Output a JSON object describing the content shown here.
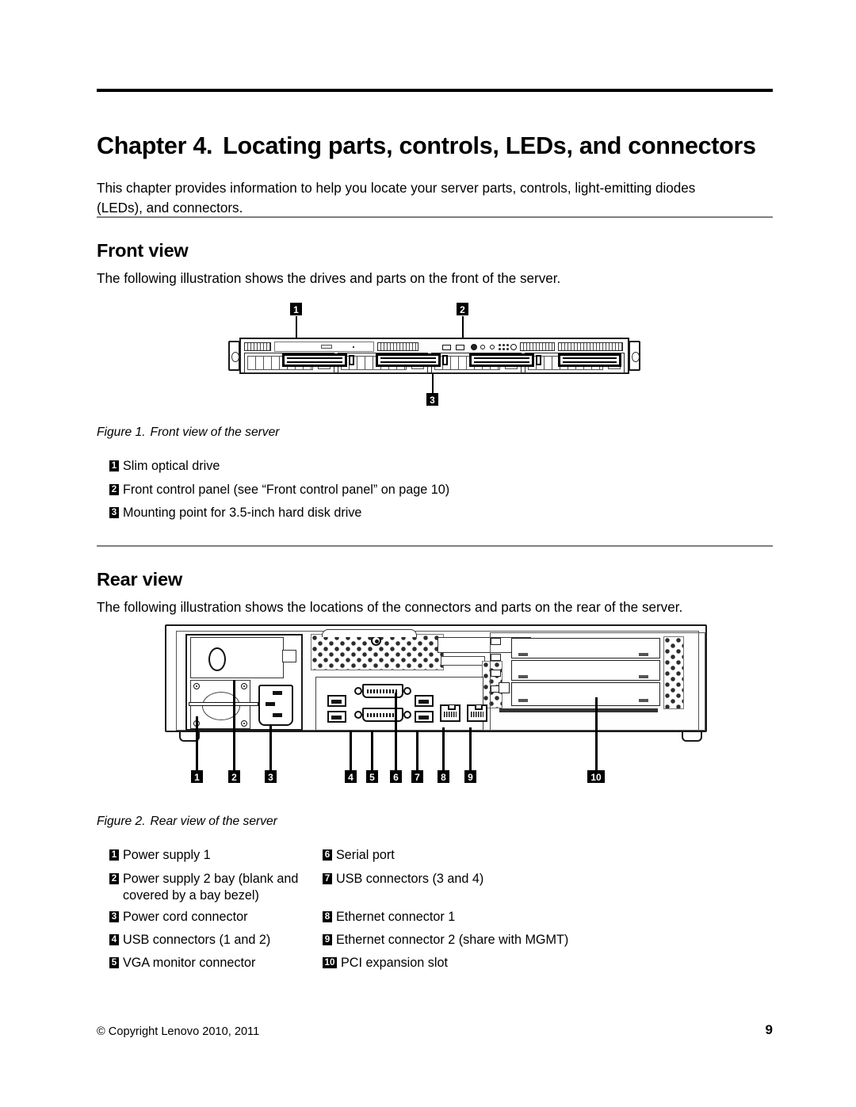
{
  "document": {
    "chapter_number": "Chapter 4.",
    "chapter_title": "Locating parts, controls, LEDs, and connectors",
    "intro": "This chapter provides information to help you locate your server parts, controls, light-emitting diodes (LEDs), and connectors."
  },
  "front_section": {
    "heading": "Front view",
    "body": "The following illustration shows the drives and parts on the front of the server.",
    "figure_label": "Figure 1.",
    "figure_caption": "Front view of the server",
    "callouts": [
      {
        "num": "1",
        "label": "Slim optical drive"
      },
      {
        "num": "2",
        "label": "Front control panel (see “Front control panel” on page 10)"
      },
      {
        "num": "3",
        "label": "Mounting point for 3.5-inch hard disk drive"
      }
    ],
    "diagram_callouts": [
      "1",
      "2",
      "3"
    ]
  },
  "rear_section": {
    "heading": "Rear view",
    "body": "The following illustration shows the locations of the connectors and parts on the rear of the server.",
    "figure_label": "Figure 2.",
    "figure_caption": "Rear view of the server",
    "callouts_left": [
      {
        "num": "1",
        "label": "Power supply 1"
      },
      {
        "num": "2",
        "label": "Power supply 2 bay (blank and covered by a bay bezel)"
      },
      {
        "num": "3",
        "label": "Power cord connector"
      },
      {
        "num": "4",
        "label": "USB connectors (1 and 2)"
      },
      {
        "num": "5",
        "label": "VGA monitor connector"
      }
    ],
    "callouts_right": [
      {
        "num": "6",
        "label": "Serial port"
      },
      {
        "num": "7",
        "label": "USB connectors (3 and 4)"
      },
      {
        "num": "8",
        "label": "Ethernet connector 1"
      },
      {
        "num": "9",
        "label": "Ethernet connector 2 (share with MGMT)"
      },
      {
        "num": "10",
        "label": "PCI expansion slot"
      }
    ],
    "diagram_callouts": [
      "1",
      "2",
      "3",
      "4",
      "5",
      "6",
      "7",
      "8",
      "9",
      "10"
    ]
  },
  "footer": {
    "copyright": "© Copyright Lenovo 2010, 2011",
    "page_number": "9"
  },
  "colors": {
    "text": "#000000",
    "rule_top": "#000000",
    "rule_section": "#808080",
    "callout_bg": "#000000",
    "callout_fg": "#ffffff",
    "page_bg": "#ffffff"
  }
}
